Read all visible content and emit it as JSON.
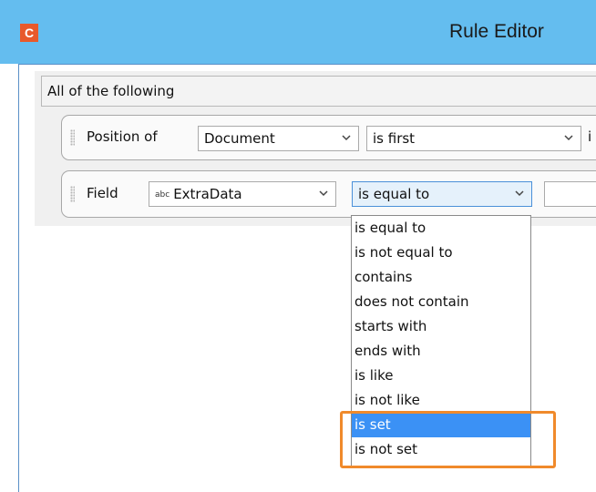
{
  "window": {
    "title": "Rule Editor",
    "app_icon_letter": "C",
    "icon_color": "#e8592b"
  },
  "group": {
    "label": "All of the following"
  },
  "condition1": {
    "label": "Position of",
    "subject": "Document",
    "operator": "is first",
    "trailing": "i"
  },
  "condition2": {
    "label": "Field",
    "field_type": "abc",
    "field_name": "ExtraData",
    "operator": "is equal to",
    "value": ""
  },
  "dropdown": {
    "options": [
      "is equal to",
      "is not equal to",
      "contains",
      "does not contain",
      "starts with",
      "ends with",
      "is like",
      "is not like",
      "is set",
      "is not set"
    ],
    "selected": "is set"
  },
  "colors": {
    "titlebar": "#64bdef",
    "selection": "#3b91f5",
    "highlight": "#f08a2b"
  }
}
